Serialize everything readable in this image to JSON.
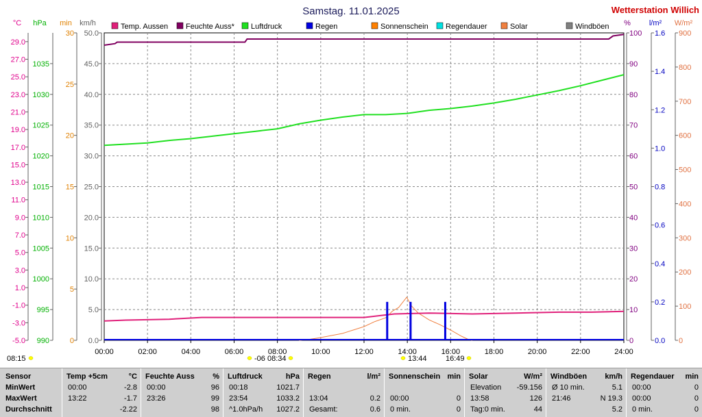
{
  "header": {
    "title": "Samstag. 11.01.2025",
    "brand": "Wetterstation Willich",
    "brand_color": "#d00000"
  },
  "axes_units": {
    "temp": "°C",
    "pressure": "hPa",
    "duration": "min",
    "wind": "km/h",
    "humidity": "%",
    "rain": "l/m²",
    "solar": "W/m²"
  },
  "chart_data": {
    "type": "line",
    "x_ticks": [
      "00:00",
      "02:00",
      "04:00",
      "06:00",
      "08:00",
      "10:00",
      "12:00",
      "14:00",
      "16:00",
      "18:00",
      "20:00",
      "22:00",
      "24:00"
    ],
    "x_range_hours": [
      0,
      24
    ],
    "grid": true,
    "legend_placement": "top",
    "axes": {
      "temp": {
        "range": [
          -5.0,
          30.0
        ],
        "ticks": [
          "-5.0",
          "-3.0",
          "-1.0",
          "1.0",
          "3.0",
          "5.0",
          "7.0",
          "9.0",
          "11.0",
          "13.0",
          "15.0",
          "17.0",
          "19.0",
          "21.0",
          "23.0",
          "25.0",
          "27.0",
          "29.0"
        ],
        "color": "#e0008c"
      },
      "pressure": {
        "range": [
          990,
          1040
        ],
        "ticks": [
          "990",
          "995",
          "1000",
          "1005",
          "1010",
          "1015",
          "1020",
          "1025",
          "1030",
          "1035"
        ],
        "color": "#00b000"
      },
      "duration": {
        "range": [
          0,
          30
        ],
        "ticks": [
          "0",
          "5",
          "10",
          "15",
          "20",
          "25",
          "30"
        ],
        "color": "#e08000"
      },
      "wind": {
        "range": [
          0.0,
          50.0
        ],
        "ticks": [
          "0.0",
          "5.0",
          "10.0",
          "15.0",
          "20.0",
          "25.0",
          "30.0",
          "35.0",
          "40.0",
          "45.0",
          "50.0"
        ],
        "color": "#606060"
      },
      "humidity": {
        "range": [
          0,
          100
        ],
        "ticks": [
          "0",
          "10",
          "20",
          "30",
          "40",
          "50",
          "60",
          "70",
          "80",
          "90",
          "100"
        ],
        "color": "#800080"
      },
      "rain": {
        "range": [
          0.0,
          1.6
        ],
        "ticks": [
          "0.0",
          "0.2",
          "0.4",
          "0.6",
          "0.8",
          "1.0",
          "1.2",
          "1.4",
          "1.6"
        ],
        "color": "#0000c0"
      },
      "solar": {
        "range": [
          0,
          900
        ],
        "ticks": [
          "0",
          "100",
          "200",
          "300",
          "400",
          "500",
          "600",
          "700",
          "800",
          "900"
        ],
        "color": "#e07040"
      }
    },
    "legend": [
      {
        "label": "Temp. Aussen",
        "color": "#e0207a"
      },
      {
        "label": "Feuchte Auss*",
        "color": "#800060"
      },
      {
        "label": "Luftdruck",
        "color": "#20e020"
      },
      {
        "label": "Regen",
        "color": "#0000e0"
      },
      {
        "label": "Sonnenschein",
        "color": "#ff8000"
      },
      {
        "label": "Regendauer",
        "color": "#00e0e0"
      },
      {
        "label": "Solar",
        "color": "#f08040"
      },
      {
        "label": "Windböen",
        "color": "#808080"
      }
    ],
    "series": [
      {
        "key": "temp",
        "name": "Temp. Aussen",
        "color": "#e0207a",
        "points": [
          [
            0,
            -2.8
          ],
          [
            1,
            -2.7
          ],
          [
            3,
            -2.6
          ],
          [
            4.5,
            -2.4
          ],
          [
            6.5,
            -2.4
          ],
          [
            8,
            -2.4
          ],
          [
            10,
            -2.4
          ],
          [
            12,
            -2.4
          ],
          [
            13.4,
            -2.0
          ],
          [
            15,
            -1.9
          ],
          [
            17,
            -2.0
          ],
          [
            19,
            -1.9
          ],
          [
            21,
            -1.8
          ],
          [
            22.5,
            -1.8
          ],
          [
            24,
            -1.7
          ]
        ]
      },
      {
        "key": "humidity",
        "name": "Feuchte Auss*",
        "color": "#800060",
        "points": [
          [
            0,
            96
          ],
          [
            0.5,
            96.5
          ],
          [
            0.6,
            97
          ],
          [
            6.5,
            97
          ],
          [
            6.6,
            98
          ],
          [
            8,
            98
          ],
          [
            12,
            98
          ],
          [
            16,
            98
          ],
          [
            20,
            98
          ],
          [
            23.3,
            98
          ],
          [
            23.5,
            99
          ],
          [
            24,
            99.5
          ]
        ]
      },
      {
        "key": "pressure",
        "name": "Luftdruck",
        "color": "#20e020",
        "points": [
          [
            0,
            1021.7
          ],
          [
            1,
            1021.9
          ],
          [
            2,
            1022.1
          ],
          [
            3,
            1022.5
          ],
          [
            4,
            1022.8
          ],
          [
            5,
            1023.2
          ],
          [
            6,
            1023.6
          ],
          [
            7,
            1024.0
          ],
          [
            8,
            1024.4
          ],
          [
            9,
            1025.2
          ],
          [
            10,
            1025.8
          ],
          [
            11,
            1026.3
          ],
          [
            12,
            1026.7
          ],
          [
            13,
            1026.7
          ],
          [
            14,
            1026.9
          ],
          [
            15,
            1027.4
          ],
          [
            16,
            1027.7
          ],
          [
            17,
            1028.1
          ],
          [
            18,
            1028.6
          ],
          [
            19,
            1029.2
          ],
          [
            20,
            1029.9
          ],
          [
            21,
            1030.6
          ],
          [
            22,
            1031.4
          ],
          [
            23,
            1032.3
          ],
          [
            24,
            1033.2
          ]
        ]
      },
      {
        "key": "solar",
        "name": "Solar",
        "color": "#f08040",
        "points": [
          [
            9.0,
            0
          ],
          [
            9.5,
            3
          ],
          [
            10,
            8
          ],
          [
            10.5,
            14
          ],
          [
            11,
            20
          ],
          [
            11.5,
            30
          ],
          [
            12,
            40
          ],
          [
            12.5,
            55
          ],
          [
            13,
            66
          ],
          [
            13.3,
            85
          ],
          [
            13.6,
            96
          ],
          [
            13.97,
            126
          ],
          [
            14.2,
            100
          ],
          [
            14.5,
            80
          ],
          [
            15,
            60
          ],
          [
            15.5,
            46
          ],
          [
            16,
            30
          ],
          [
            16.5,
            12
          ],
          [
            16.8,
            3
          ],
          [
            17,
            0
          ]
        ]
      },
      {
        "key": "rain",
        "name": "Regen",
        "color": "#0000e0",
        "bars": [
          [
            13.07,
            0.2
          ],
          [
            14.15,
            0.2
          ],
          [
            15.75,
            0.2
          ]
        ]
      }
    ],
    "marker_row": [
      {
        "time": "08:15",
        "dot_color": "#ffff00"
      },
      {
        "time": "-06",
        "dot_color": "#ffff00"
      },
      {
        "time": "08:34",
        "dot_color": "#ffff00"
      },
      {
        "time": "13:44",
        "dot_color": "#ffff00"
      },
      {
        "time": "16:49",
        "dot_color": "#ffff00"
      }
    ]
  },
  "summary": {
    "row_labels": [
      "Sensor",
      "MinWert",
      "MaxWert",
      "Durchschnitt"
    ],
    "columns": [
      {
        "title": "Temp +5cm",
        "unit": "°C",
        "rows": [
          [
            "00:00",
            "-2.8"
          ],
          [
            "13:22",
            "-1.7"
          ],
          [
            "",
            "-2.22"
          ]
        ]
      },
      {
        "title": "Feuchte Auss",
        "unit": "%",
        "rows": [
          [
            "00:00",
            "96"
          ],
          [
            "23:26",
            "99"
          ],
          [
            "",
            "98"
          ]
        ]
      },
      {
        "title": "Luftdruck",
        "unit": "hPa",
        "rows": [
          [
            "00:18",
            "1021.7"
          ],
          [
            "23:54",
            "1033.2"
          ],
          [
            "^1.0hPa/h",
            "1027.2"
          ]
        ]
      },
      {
        "title": "Regen",
        "unit": "l/m²",
        "rows": [
          [
            "",
            ""
          ],
          [
            "13:04",
            "0.2"
          ],
          [
            "Gesamt:",
            "0.6"
          ]
        ]
      },
      {
        "title": "Sonnenschein",
        "unit": "min",
        "rows": [
          [
            "",
            ""
          ],
          [
            "00:00",
            "0"
          ],
          [
            "0 min.",
            "0"
          ]
        ]
      },
      {
        "title": "Solar",
        "unit": "W/m²",
        "rows": [
          [
            "Elevation",
            "-59.156"
          ],
          [
            "13:58",
            "126"
          ],
          [
            "Tag:0 min.",
            "44"
          ]
        ]
      },
      {
        "title": "Windböen",
        "unit": "km/h",
        "rows": [
          [
            "Ø 10 min.",
            "5.1"
          ],
          [
            "21:46",
            "N 19.3"
          ],
          [
            "",
            "5.2"
          ]
        ]
      },
      {
        "title": "Regendauer",
        "unit": "min",
        "rows": [
          [
            "00:00",
            "0"
          ],
          [
            "00:00",
            "0"
          ],
          [
            "0 min.",
            "0"
          ]
        ]
      }
    ]
  }
}
